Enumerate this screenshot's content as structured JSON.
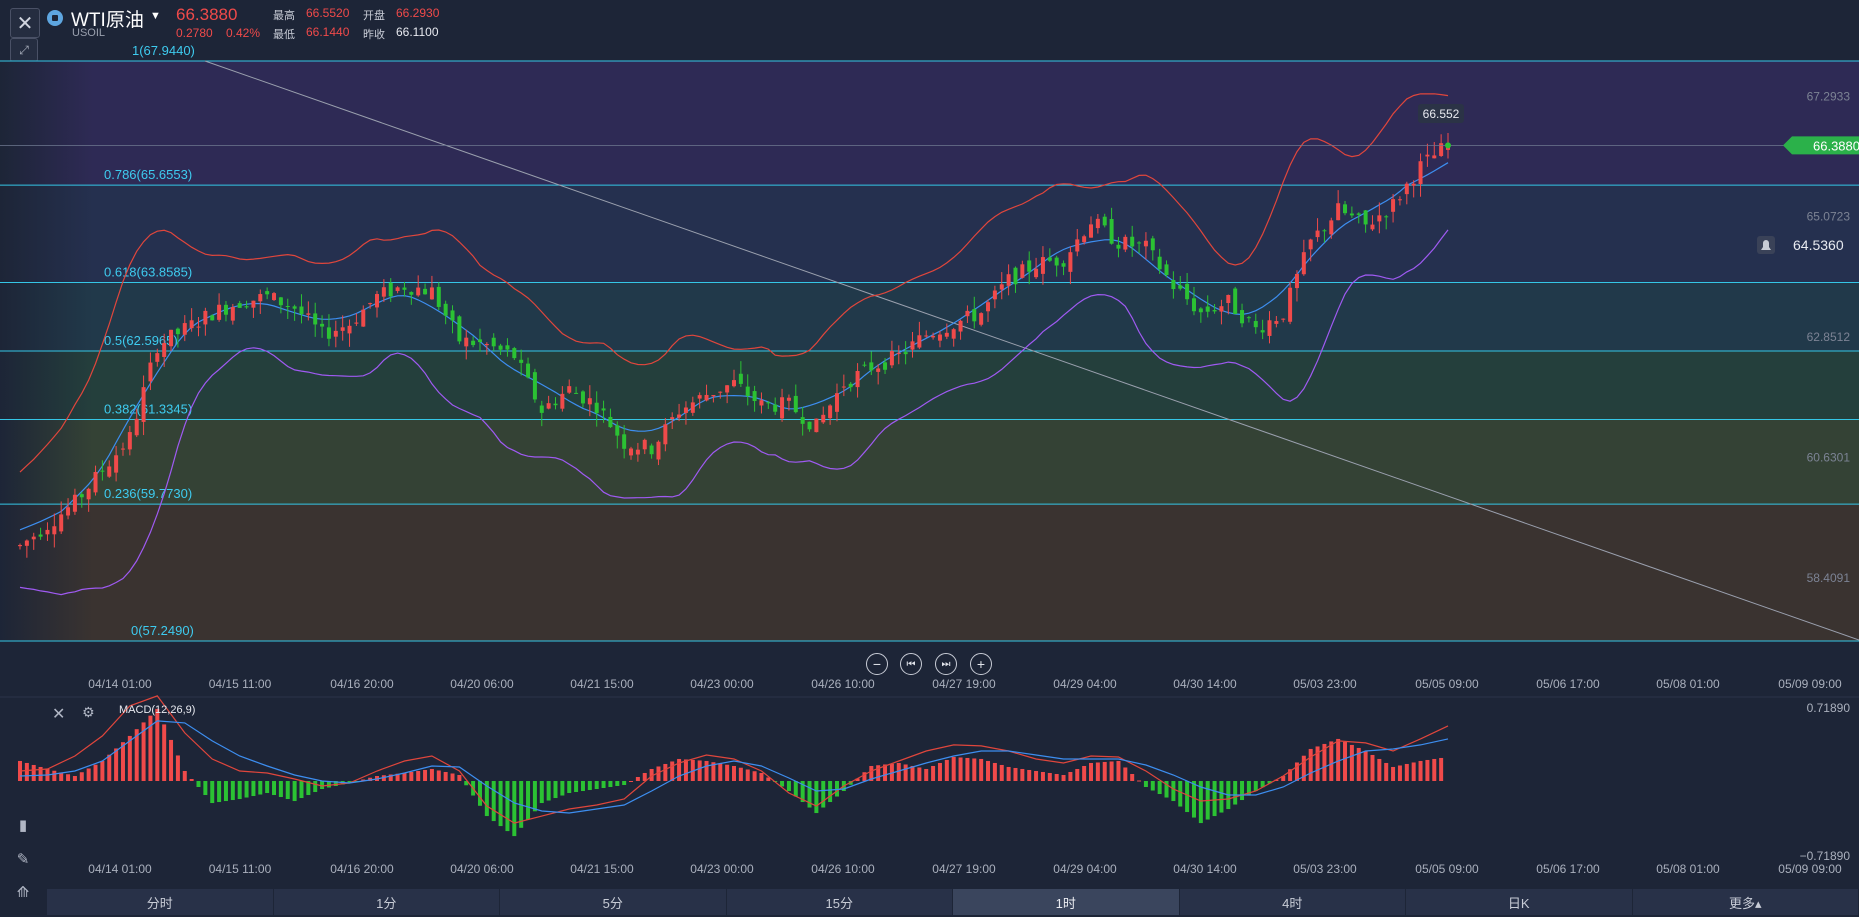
{
  "header": {
    "symbol_name": "WTI原油",
    "symbol_code": "USOIL",
    "last_price": "66.3880",
    "change": "0.2780",
    "change_pct": "0.42%",
    "high_label": "最高",
    "high": "66.5520",
    "open_label": "开盘",
    "open": "66.2930",
    "low_label": "最低",
    "low": "66.1440",
    "prev_close_label": "昨收",
    "prev_close": "66.1100"
  },
  "chart_data": {
    "type": "candlestick",
    "title": "WTI原油 USOIL 1时",
    "ylim": [
      56.9,
      68.3
    ],
    "y_ticks": [
      "67.2933",
      "65.0723",
      "62.8512",
      "60.6301",
      "58.4091"
    ],
    "x_ticks": [
      "04/14 01:00",
      "04/15 11:00",
      "04/16 20:00",
      "04/20 06:00",
      "04/21 15:00",
      "04/23 00:00",
      "04/26 10:00",
      "04/27 19:00",
      "04/29 04:00",
      "04/30 14:00",
      "05/03 23:00",
      "05/05 09:00",
      "05/06 17:00",
      "05/08 01:00",
      "05/09 09:00"
    ],
    "fib_levels": [
      {
        "label": "1(67.9440)",
        "value": 67.944
      },
      {
        "label": "0.786(65.6553)",
        "value": 65.6553
      },
      {
        "label": "0.618(63.8585)",
        "value": 63.8585
      },
      {
        "label": "0.5(62.5965)",
        "value": 62.5965
      },
      {
        "label": "0.382(61.3345)",
        "value": 61.3345
      },
      {
        "label": "0.236(59.7730)",
        "value": 59.773
      },
      {
        "label": "0(57.2490)",
        "value": 57.249
      }
    ],
    "current_price_label": "66.3880",
    "alert_price_label": "64.5360",
    "peak_label": "66.552",
    "close_path": [
      59.0,
      59.4,
      59.8,
      60.4,
      61.0,
      62.7,
      63.0,
      63.3,
      63.5,
      63.6,
      63.4,
      62.9,
      63.1,
      63.6,
      63.8,
      63.7,
      62.8,
      62.7,
      62.5,
      61.5,
      61.9,
      61.6,
      60.9,
      60.8,
      61.5,
      61.8,
      62.0,
      61.6,
      61.6,
      61.2,
      62.0,
      62.3,
      62.5,
      62.9,
      63.1,
      63.3,
      63.9,
      64.2,
      64.3,
      65.0,
      64.6,
      64.5,
      63.8,
      63.3,
      63.5,
      63.0,
      63.3,
      64.6,
      65.2,
      64.9,
      65.3,
      66.0,
      66.4
    ]
  },
  "macd": {
    "label": "MACD(12,26,9)",
    "top_value": "0.71890",
    "bottom_value": "−0.71890",
    "hist": [
      0.2,
      0.12,
      0.05,
      0.2,
      0.45,
      0.72,
      0.1,
      -0.22,
      -0.18,
      -0.12,
      -0.2,
      -0.08,
      -0.02,
      0.05,
      0.08,
      0.12,
      0.06,
      -0.35,
      -0.55,
      -0.22,
      -0.12,
      -0.08,
      -0.04,
      0.12,
      0.22,
      0.2,
      0.15,
      0.08,
      -0.1,
      -0.32,
      -0.1,
      0.15,
      0.18,
      0.12,
      0.24,
      0.22,
      0.14,
      0.1,
      0.06,
      0.18,
      0.2,
      -0.06,
      -0.2,
      -0.42,
      -0.28,
      -0.1,
      0.05,
      0.32,
      0.42,
      0.3,
      0.14,
      0.2,
      0.24
    ],
    "dif": [
      0.1,
      0.12,
      0.25,
      0.45,
      0.75,
      0.85,
      0.48,
      0.22,
      0.1,
      0.08,
      0.02,
      -0.05,
      -0.02,
      0.1,
      0.2,
      0.25,
      0.1,
      -0.25,
      -0.42,
      -0.35,
      -0.28,
      -0.24,
      -0.18,
      0.05,
      0.18,
      0.26,
      0.22,
      0.1,
      -0.12,
      -0.25,
      -0.05,
      0.1,
      0.2,
      0.3,
      0.36,
      0.35,
      0.3,
      0.22,
      0.18,
      0.25,
      0.24,
      0.1,
      -0.08,
      -0.2,
      -0.18,
      -0.1,
      0.05,
      0.24,
      0.4,
      0.38,
      0.3,
      0.42,
      0.55
    ],
    "dea": [
      0.05,
      0.06,
      0.1,
      0.2,
      0.4,
      0.6,
      0.58,
      0.4,
      0.25,
      0.15,
      0.06,
      0.0,
      -0.02,
      0.02,
      0.08,
      0.15,
      0.14,
      -0.05,
      -0.22,
      -0.3,
      -0.32,
      -0.28,
      -0.24,
      -0.1,
      0.05,
      0.15,
      0.2,
      0.15,
      0.03,
      -0.1,
      -0.08,
      0.02,
      0.1,
      0.18,
      0.25,
      0.3,
      0.3,
      0.26,
      0.22,
      0.22,
      0.22,
      0.16,
      0.06,
      -0.06,
      -0.14,
      -0.14,
      -0.06,
      0.08,
      0.2,
      0.3,
      0.32,
      0.36,
      0.42
    ]
  },
  "controls": {
    "zoom_out": "−",
    "step_back": "⏮",
    "step_forward": "⏭",
    "zoom_in": "+"
  },
  "period_tabs": [
    "分时",
    "1分",
    "5分",
    "15分",
    "1时",
    "4时",
    "日K",
    "更多▴"
  ],
  "active_period": "1时",
  "colors": {
    "up": "#f04a4a",
    "down": "#2bc233",
    "boll_upper": "#e0463c",
    "boll_mid": "#3d8ef0",
    "boll_lower": "#9f5af2",
    "fib_line": "#35c6e6",
    "price_tag": "#2bb14a"
  }
}
